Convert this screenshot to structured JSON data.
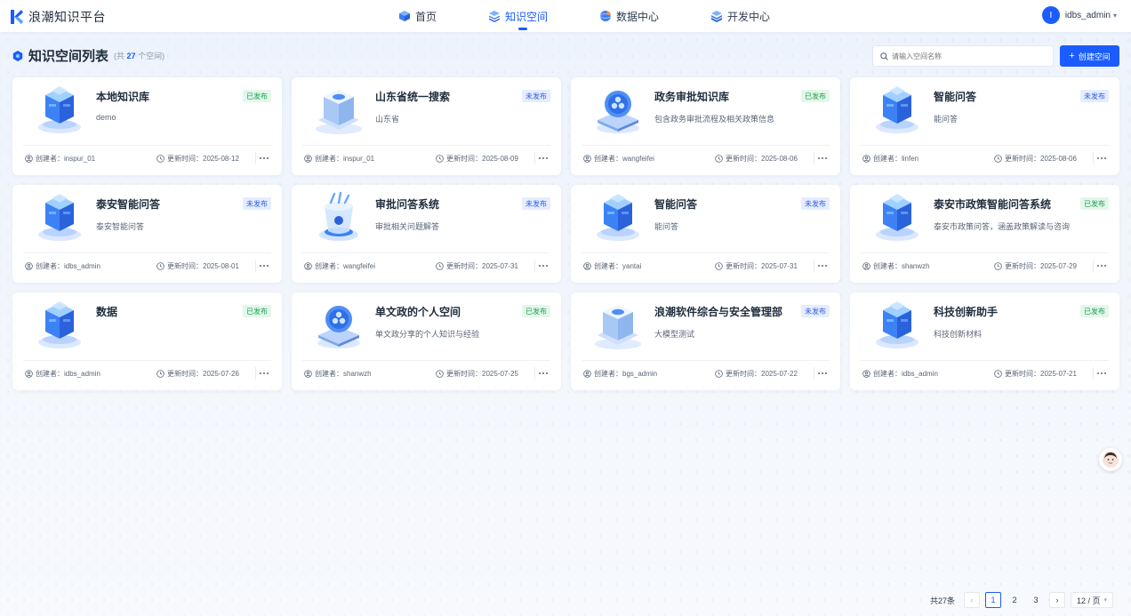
{
  "app": {
    "title": "浪潮知识平台"
  },
  "nav": {
    "items": [
      {
        "label": "首页",
        "icon": "cube-icon",
        "active": false
      },
      {
        "label": "知识空间",
        "icon": "layers-icon",
        "active": true
      },
      {
        "label": "数据中心",
        "icon": "globe-icon",
        "active": false
      },
      {
        "label": "开发中心",
        "icon": "stack-icon",
        "active": false
      }
    ]
  },
  "user": {
    "avatar_letter": "I",
    "name": "idbs_admin"
  },
  "page": {
    "title": "知识空间列表",
    "count_prefix": "(共",
    "count": "27",
    "count_suffix": "个空间)"
  },
  "search": {
    "placeholder": "请输入空间名称"
  },
  "create_button": {
    "label": "创建空间"
  },
  "cards": [
    {
      "title": "本地知识库",
      "desc": "demo",
      "status": "已发布",
      "published": true,
      "creator": "创建者：inspur_01",
      "updated": "更新时间：2025-08-12",
      "image": "cube-stack"
    },
    {
      "title": "山东省统一搜索",
      "desc": "山东省",
      "status": "未发布",
      "published": false,
      "creator": "创建者：inspur_01",
      "updated": "更新时间：2025-08-09",
      "image": "glass-tower"
    },
    {
      "title": "政务审批知识库",
      "desc": "包含政务审批流程及相关政策信息",
      "status": "已发布",
      "published": true,
      "creator": "创建者：wangfeifei",
      "updated": "更新时间：2025-08-06",
      "image": "orb-platform"
    },
    {
      "title": "智能问答",
      "desc": "能问答",
      "status": "未发布",
      "published": false,
      "creator": "创建者：linfen",
      "updated": "更新时间：2025-08-06",
      "image": "cube-stack"
    },
    {
      "title": "泰安智能问答",
      "desc": "泰安智能问答",
      "status": "未发布",
      "published": false,
      "creator": "创建者：idbs_admin",
      "updated": "更新时间：2025-08-01",
      "image": "cube-stack"
    },
    {
      "title": "审批问答系统",
      "desc": "审批相关问题解答",
      "status": "未发布",
      "published": false,
      "creator": "创建者：wangfeifei",
      "updated": "更新时间：2025-07-31",
      "image": "glass-cup"
    },
    {
      "title": "智能问答",
      "desc": "能问答",
      "status": "未发布",
      "published": false,
      "creator": "创建者：yantai",
      "updated": "更新时间：2025-07-31",
      "image": "cube-stack"
    },
    {
      "title": "泰安市政策智能问答系统",
      "desc": "泰安市政策问答，涵盖政策解读与咨询",
      "status": "已发布",
      "published": true,
      "creator": "创建者：shanwzh",
      "updated": "更新时间：2025-07-29",
      "image": "cube-stack"
    },
    {
      "title": "数据",
      "desc": "",
      "status": "已发布",
      "published": true,
      "creator": "创建者：idbs_admin",
      "updated": "更新时间：2025-07-26",
      "image": "cube-stack"
    },
    {
      "title": "单文政的个人空间",
      "desc": "单文政分享的个人知识与经验",
      "status": "已发布",
      "published": true,
      "creator": "创建者：shanwzh",
      "updated": "更新时间：2025-07-25",
      "image": "orb-platform"
    },
    {
      "title": "浪潮软件综合与安全管理部",
      "desc": "大模型测试",
      "status": "未发布",
      "published": false,
      "creator": "创建者：bgs_admin",
      "updated": "更新时间：2025-07-22",
      "image": "glass-tower"
    },
    {
      "title": "科技创新助手",
      "desc": "科技创新材料",
      "status": "已发布",
      "published": true,
      "creator": "创建者：idbs_admin",
      "updated": "更新时间：2025-07-21",
      "image": "cube-stack"
    }
  ],
  "pagination": {
    "total": "共27条",
    "pages": [
      "1",
      "2",
      "3"
    ],
    "current": "1",
    "page_size": "12 / 页"
  },
  "colors": {
    "primary": "#1a5cff",
    "published_bg": "#e3f7ea",
    "published_fg": "#1e9f52",
    "unpublished_bg": "#e5edff",
    "unpublished_fg": "#2f5ee0"
  }
}
